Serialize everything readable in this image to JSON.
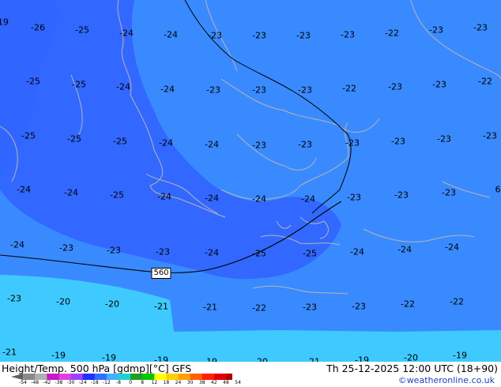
{
  "map": {
    "colors": {
      "field_minus26": "#2a5cff",
      "field_minus24": "#3268ff",
      "field_minus22": "#3a8aff",
      "field_minus20": "#38b4f8",
      "field_minus18": "#3fcaff",
      "coast": "#b5b5b5",
      "contour": "#000000"
    },
    "temperature_labels": [
      "-26",
      "-25",
      "-24",
      "-24",
      "-23",
      "-23",
      "-23",
      "-23",
      "-22",
      "-23",
      "-23",
      "-25",
      "-25",
      "-24",
      "-24",
      "-23",
      "-23",
      "-23",
      "-22",
      "-23",
      "-23",
      "-22",
      "-25",
      "-25",
      "-25",
      "-24",
      "-24",
      "-23",
      "-23",
      "-23",
      "-23",
      "-23",
      "-23",
      "-24",
      "-24",
      "-25",
      "-24",
      "-24",
      "-24",
      "-24",
      "-23",
      "-23",
      "-23",
      "-24",
      "-23",
      "-23",
      "-23",
      "-24",
      "-25",
      "-25",
      "-24",
      "-24",
      "-24",
      "-23",
      "-20",
      "-20",
      "-21",
      "-21",
      "-22",
      "-23",
      "-23",
      "-22",
      "-22",
      "-21",
      "-19",
      "-19",
      "-19",
      "-19",
      "-20",
      "-21",
      "-19",
      "-20",
      "-19",
      "-19",
      "6",
      "-2"
    ],
    "contour_label": "560"
  },
  "footer": {
    "title_left": "Height/Temp. 500 hPa [gdmp][°C] GFS",
    "title_right": "Th 25-12-2025 12:00 UTC (18+90)",
    "credit": "©weatheronline.co.uk",
    "colorbar": {
      "ticks": [
        "-54",
        "-48",
        "-42",
        "-38",
        "-30",
        "-24",
        "-18",
        "-12",
        "-8",
        "0",
        "8",
        "12",
        "18",
        "24",
        "30",
        "38",
        "42",
        "48",
        "54"
      ],
      "colors": [
        "#606060",
        "#8a8a8a",
        "#b0b0b0",
        "#c818c8",
        "#e040e0",
        "#a040ff",
        "#2030ff",
        "#3070ff",
        "#40b0ff",
        "#20d0d0",
        "#20a020",
        "#00c800",
        "#ffff00",
        "#ffd000",
        "#ffa000",
        "#ff6000",
        "#ff2000",
        "#e00000",
        "#b00000",
        "#800000"
      ]
    }
  }
}
